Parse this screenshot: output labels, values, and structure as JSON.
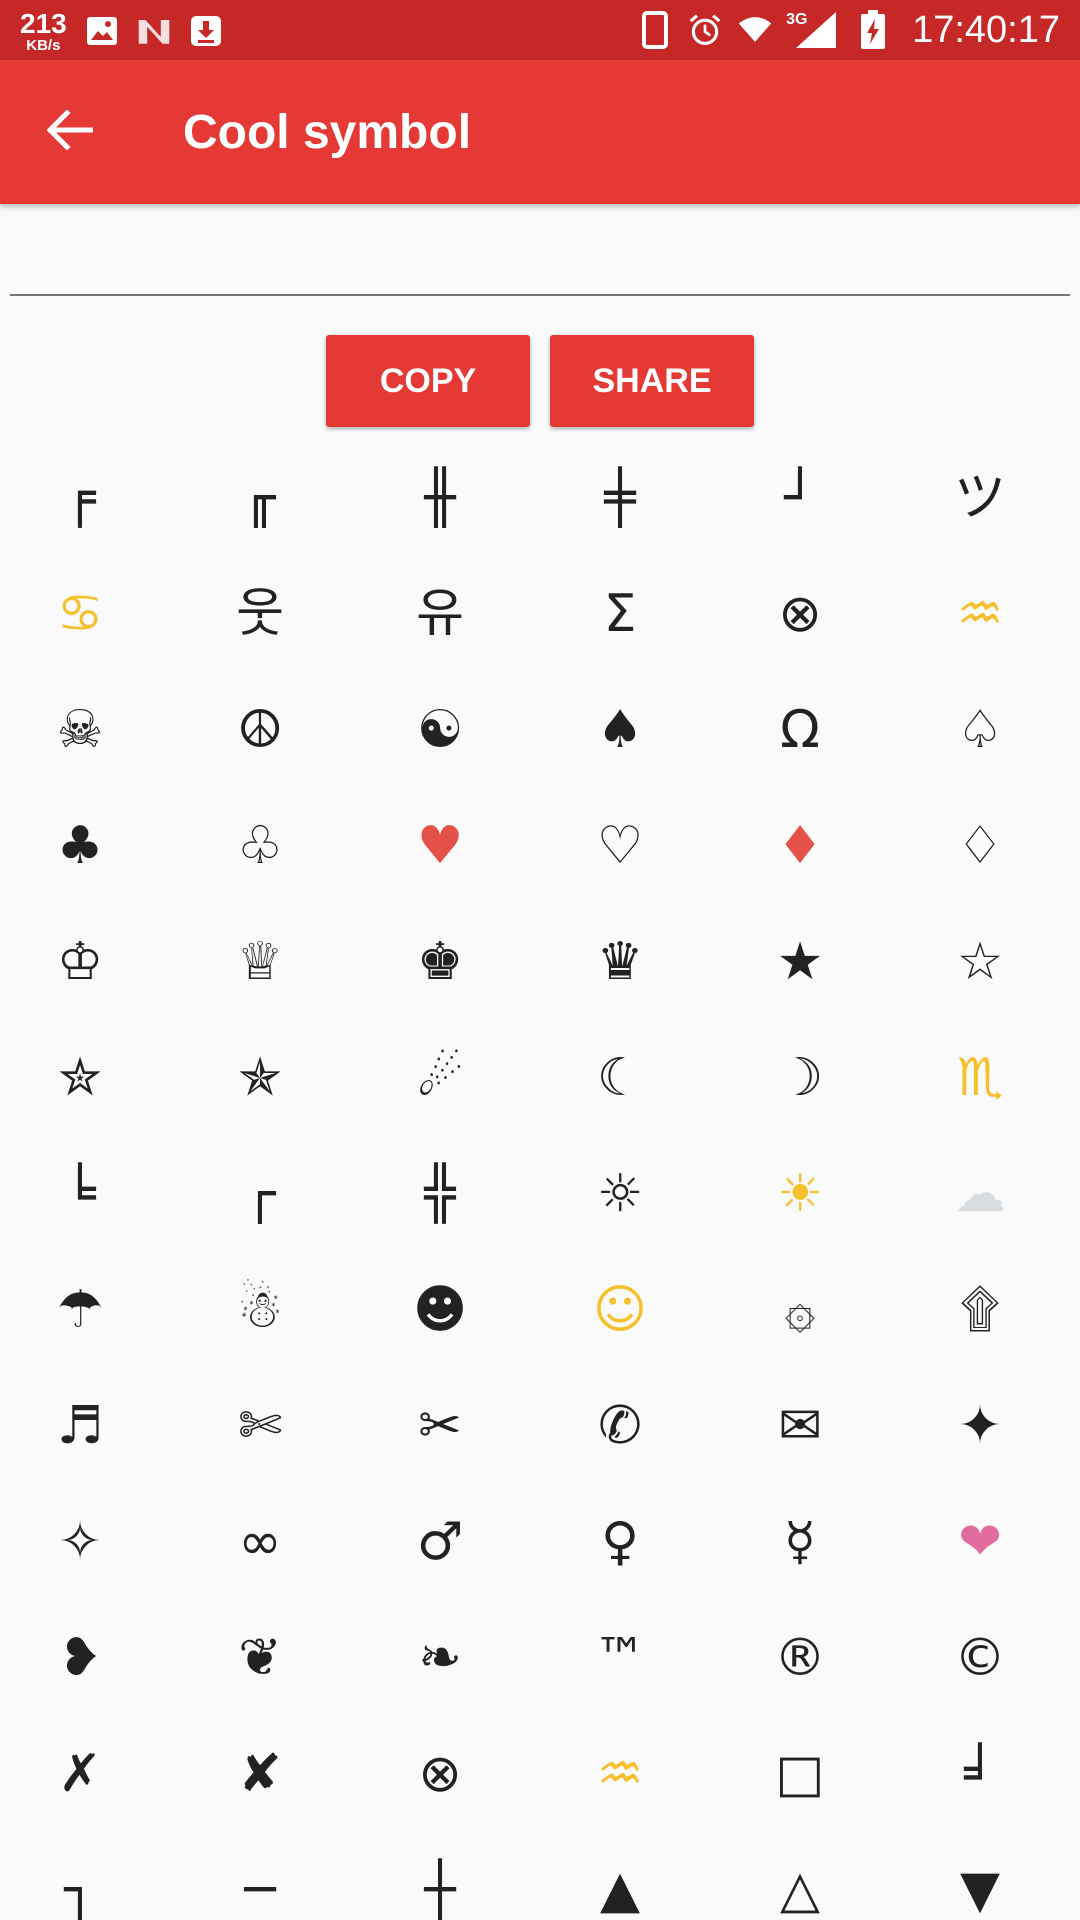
{
  "status_bar": {
    "net_speed_value": "213",
    "net_speed_unit": "KB/s",
    "network_type": "3G",
    "time": "17:40:17"
  },
  "app_bar": {
    "title": "Cool symbol"
  },
  "input": {
    "value": "",
    "placeholder": ""
  },
  "buttons": {
    "copy_label": "COPY",
    "share_label": "SHARE"
  },
  "colors": {
    "status_bar": "#c62828",
    "app_bar": "#e53935",
    "button": "#e53935",
    "background": "#fafafa",
    "symbol_default": "#222222",
    "yellow": "#f6c02c",
    "red": "#e35149",
    "pink": "#e26b9f"
  },
  "symbols": [
    {
      "char": "╒"
    },
    {
      "char": "╓"
    },
    {
      "char": "╫"
    },
    {
      "char": "╪"
    },
    {
      "char": "┘"
    },
    {
      "char": "ツ"
    },
    {
      "char": "♋",
      "color": "#f6c02c"
    },
    {
      "char": "웃"
    },
    {
      "char": "유"
    },
    {
      "char": "Σ"
    },
    {
      "char": "⊗"
    },
    {
      "char": "♒",
      "color": "#f6c02c"
    },
    {
      "char": "☠"
    },
    {
      "char": "☮"
    },
    {
      "char": "☯"
    },
    {
      "char": "♠"
    },
    {
      "char": "Ω"
    },
    {
      "char": "♤"
    },
    {
      "char": "♣"
    },
    {
      "char": "♧"
    },
    {
      "char": "♥",
      "color": "#e35149"
    },
    {
      "char": "♡"
    },
    {
      "char": "♦",
      "color": "#e35149"
    },
    {
      "char": "♢"
    },
    {
      "char": "♔"
    },
    {
      "char": "♕"
    },
    {
      "char": "♚"
    },
    {
      "char": "♛"
    },
    {
      "char": "★"
    },
    {
      "char": "☆"
    },
    {
      "char": "✮"
    },
    {
      "char": "✯"
    },
    {
      "char": "☄"
    },
    {
      "char": "☾"
    },
    {
      "char": "☽"
    },
    {
      "char": "♏",
      "color": "#f6c02c"
    },
    {
      "char": "╘"
    },
    {
      "char": "┌"
    },
    {
      "char": "╬"
    },
    {
      "char": "☼"
    },
    {
      "char": "☀",
      "color": "#f6c02c"
    },
    {
      "char": "☁",
      "color": "#d8dde2"
    },
    {
      "char": "☂"
    },
    {
      "char": "☃"
    },
    {
      "char": "☻"
    },
    {
      "char": "☺",
      "color": "#f6c02c"
    },
    {
      "char": "۞"
    },
    {
      "char": "۩"
    },
    {
      "char": "♬"
    },
    {
      "char": "✄"
    },
    {
      "char": "✂"
    },
    {
      "char": "✆"
    },
    {
      "char": "✉"
    },
    {
      "char": "✦"
    },
    {
      "char": "✧"
    },
    {
      "char": "∞"
    },
    {
      "char": "♂"
    },
    {
      "char": "♀"
    },
    {
      "char": "☿"
    },
    {
      "char": "❤",
      "color": "#e26b9f"
    },
    {
      "char": "❥"
    },
    {
      "char": "❦"
    },
    {
      "char": "❧"
    },
    {
      "char": "™"
    },
    {
      "char": "®"
    },
    {
      "char": "©"
    },
    {
      "char": "✗"
    },
    {
      "char": "✘"
    },
    {
      "char": "⊗"
    },
    {
      "char": "♒",
      "color": "#f6c02c"
    },
    {
      "char": "□"
    },
    {
      "char": "╛"
    },
    {
      "char": "┐"
    },
    {
      "char": "─"
    },
    {
      "char": "┼"
    },
    {
      "char": "▲"
    },
    {
      "char": "△"
    },
    {
      "char": "▼"
    }
  ]
}
